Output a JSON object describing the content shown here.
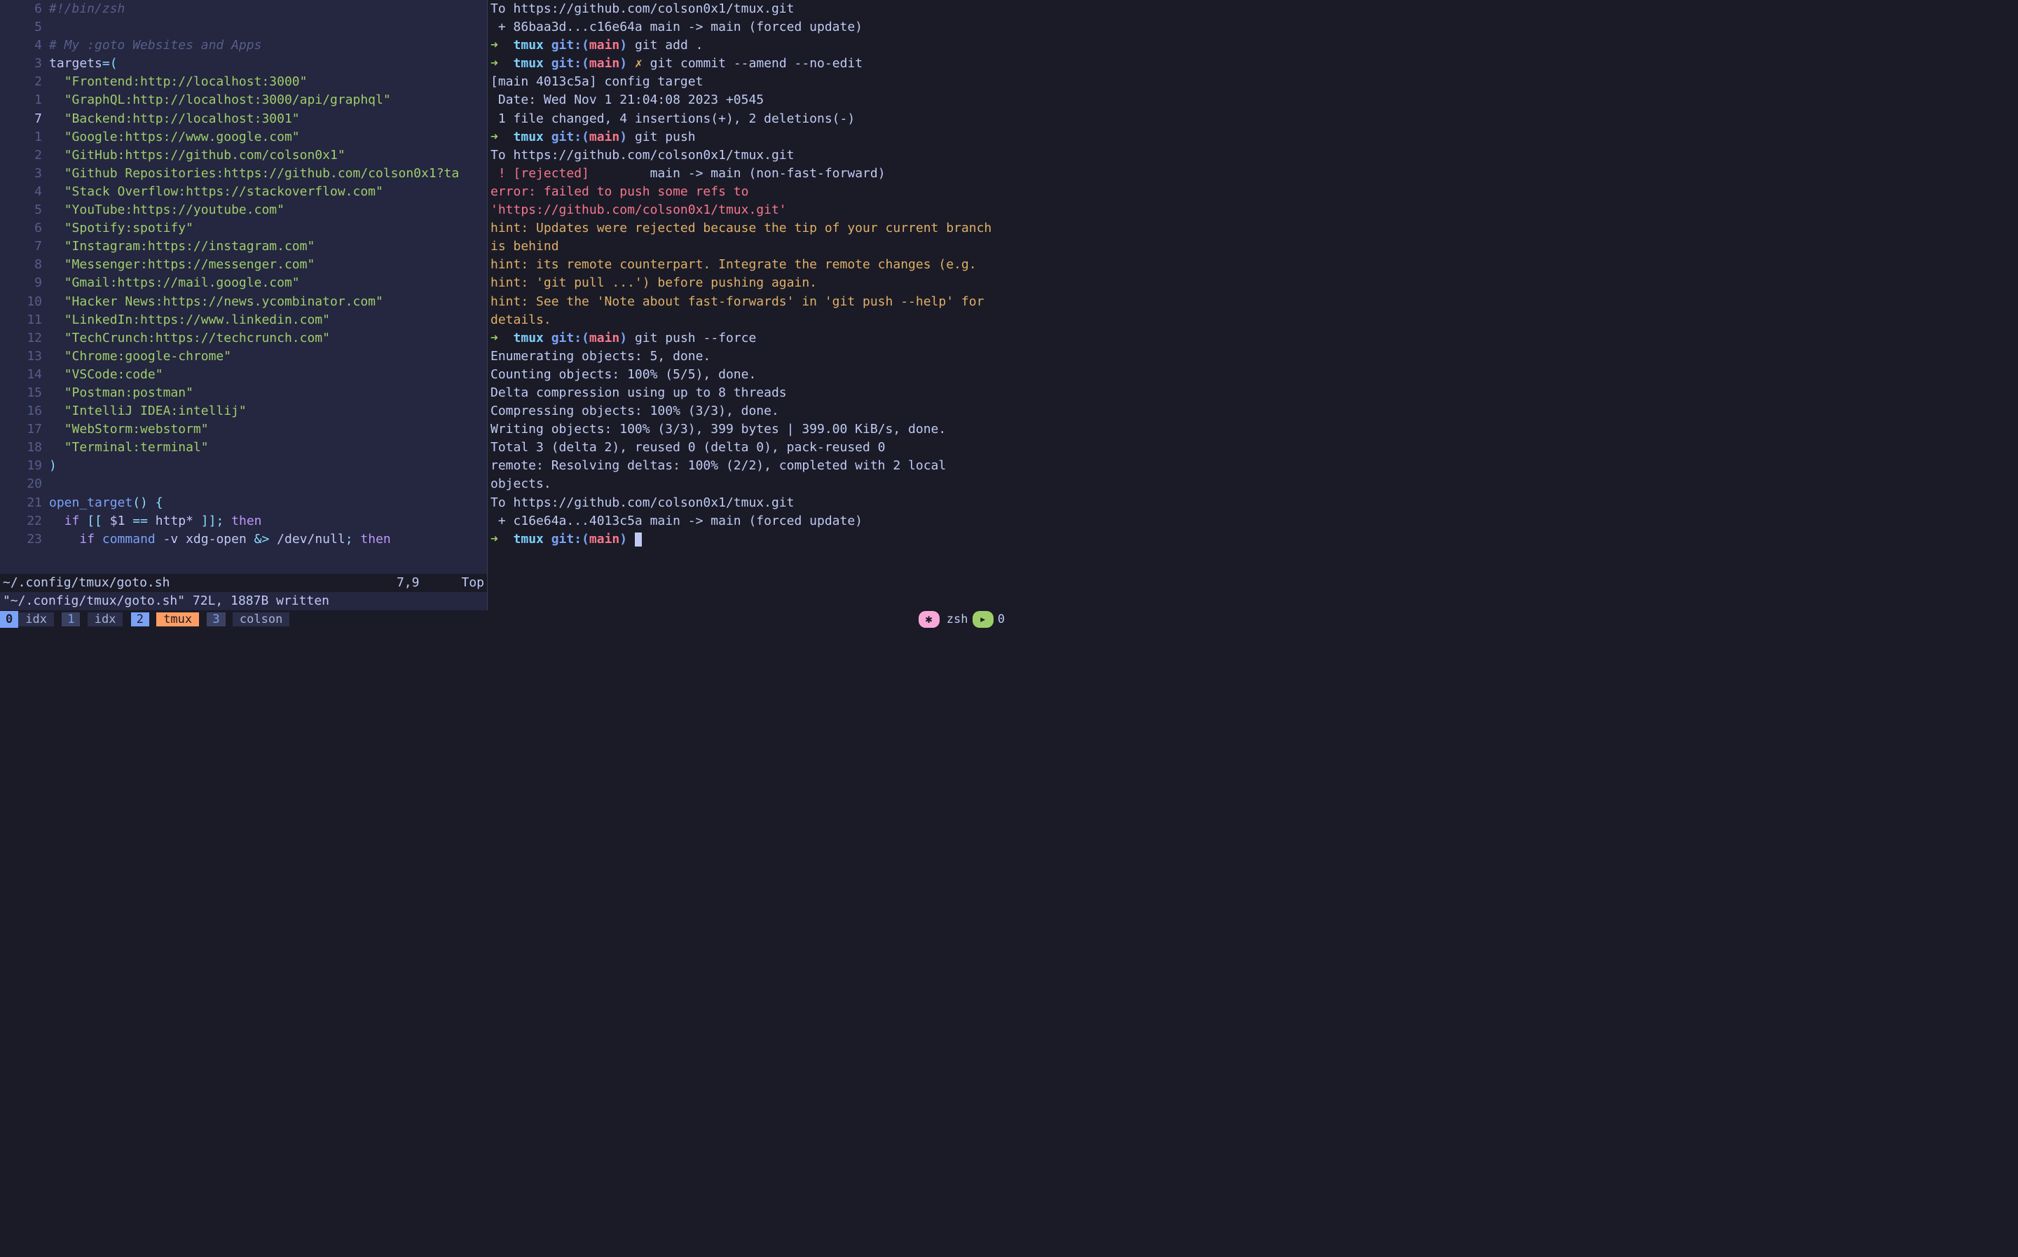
{
  "left": {
    "lines": [
      {
        "n": "6",
        "cursor": false,
        "segs": [
          {
            "cls": "comment",
            "t": "#!/bin/zsh"
          }
        ]
      },
      {
        "n": "5",
        "cursor": false,
        "segs": []
      },
      {
        "n": "4",
        "cursor": false,
        "segs": [
          {
            "cls": "comment",
            "t": "# My :goto Websites and Apps"
          }
        ]
      },
      {
        "n": "3",
        "cursor": false,
        "segs": [
          {
            "cls": "var",
            "t": "targets"
          },
          {
            "cls": "op",
            "t": "=("
          }
        ]
      },
      {
        "n": "2",
        "cursor": false,
        "segs": [
          {
            "cls": "",
            "t": "  "
          },
          {
            "cls": "string",
            "t": "\"Frontend:http://localhost:3000\""
          }
        ]
      },
      {
        "n": "1",
        "cursor": false,
        "segs": [
          {
            "cls": "",
            "t": "  "
          },
          {
            "cls": "string",
            "t": "\"GraphQL:http://localhost:3000/api/graphql\""
          }
        ]
      },
      {
        "n": "7",
        "cursor": true,
        "segs": [
          {
            "cls": "",
            "t": "  "
          },
          {
            "cls": "string",
            "t": "\"Backend:http://localhost:3001\""
          }
        ]
      },
      {
        "n": "1",
        "cursor": false,
        "segs": [
          {
            "cls": "",
            "t": "  "
          },
          {
            "cls": "string",
            "t": "\"Google:https://www.google.com\""
          }
        ]
      },
      {
        "n": "2",
        "cursor": false,
        "segs": [
          {
            "cls": "",
            "t": "  "
          },
          {
            "cls": "string",
            "t": "\"GitHub:https://github.com/colson0x1\""
          }
        ]
      },
      {
        "n": "3",
        "cursor": false,
        "segs": [
          {
            "cls": "",
            "t": "  "
          },
          {
            "cls": "string",
            "t": "\"Github Repositories:https://github.com/colson0x1?ta"
          }
        ]
      },
      {
        "n": "4",
        "cursor": false,
        "segs": [
          {
            "cls": "",
            "t": "  "
          },
          {
            "cls": "string",
            "t": "\"Stack Overflow:https://stackoverflow.com\""
          }
        ]
      },
      {
        "n": "5",
        "cursor": false,
        "segs": [
          {
            "cls": "",
            "t": "  "
          },
          {
            "cls": "string",
            "t": "\"YouTube:https://youtube.com\""
          }
        ]
      },
      {
        "n": "6",
        "cursor": false,
        "segs": [
          {
            "cls": "",
            "t": "  "
          },
          {
            "cls": "string",
            "t": "\"Spotify:spotify\""
          }
        ]
      },
      {
        "n": "7",
        "cursor": false,
        "segs": [
          {
            "cls": "",
            "t": "  "
          },
          {
            "cls": "string",
            "t": "\"Instagram:https://instagram.com\""
          }
        ]
      },
      {
        "n": "8",
        "cursor": false,
        "segs": [
          {
            "cls": "",
            "t": "  "
          },
          {
            "cls": "string",
            "t": "\"Messenger:https://messenger.com\""
          }
        ]
      },
      {
        "n": "9",
        "cursor": false,
        "segs": [
          {
            "cls": "",
            "t": "  "
          },
          {
            "cls": "string",
            "t": "\"Gmail:https://mail.google.com\""
          }
        ]
      },
      {
        "n": "10",
        "cursor": false,
        "segs": [
          {
            "cls": "",
            "t": "  "
          },
          {
            "cls": "string",
            "t": "\"Hacker News:https://news.ycombinator.com\""
          }
        ]
      },
      {
        "n": "11",
        "cursor": false,
        "segs": [
          {
            "cls": "",
            "t": "  "
          },
          {
            "cls": "string",
            "t": "\"LinkedIn:https://www.linkedin.com\""
          }
        ]
      },
      {
        "n": "12",
        "cursor": false,
        "segs": [
          {
            "cls": "",
            "t": "  "
          },
          {
            "cls": "string",
            "t": "\"TechCrunch:https://techcrunch.com\""
          }
        ]
      },
      {
        "n": "13",
        "cursor": false,
        "segs": [
          {
            "cls": "",
            "t": "  "
          },
          {
            "cls": "string",
            "t": "\"Chrome:google-chrome\""
          }
        ]
      },
      {
        "n": "14",
        "cursor": false,
        "segs": [
          {
            "cls": "",
            "t": "  "
          },
          {
            "cls": "string",
            "t": "\"VSCode:code\""
          }
        ]
      },
      {
        "n": "15",
        "cursor": false,
        "segs": [
          {
            "cls": "",
            "t": "  "
          },
          {
            "cls": "string",
            "t": "\"Postman:postman\""
          }
        ]
      },
      {
        "n": "16",
        "cursor": false,
        "segs": [
          {
            "cls": "",
            "t": "  "
          },
          {
            "cls": "string",
            "t": "\"IntelliJ IDEA:intellij\""
          }
        ]
      },
      {
        "n": "17",
        "cursor": false,
        "segs": [
          {
            "cls": "",
            "t": "  "
          },
          {
            "cls": "string",
            "t": "\"WebStorm:webstorm\""
          }
        ]
      },
      {
        "n": "18",
        "cursor": false,
        "segs": [
          {
            "cls": "",
            "t": "  "
          },
          {
            "cls": "string",
            "t": "\"Terminal:terminal\""
          }
        ]
      },
      {
        "n": "19",
        "cursor": false,
        "segs": [
          {
            "cls": "op",
            "t": ")"
          }
        ]
      },
      {
        "n": "20",
        "cursor": false,
        "segs": []
      },
      {
        "n": "21",
        "cursor": false,
        "segs": [
          {
            "cls": "func",
            "t": "open_target"
          },
          {
            "cls": "op",
            "t": "() {"
          }
        ]
      },
      {
        "n": "22",
        "cursor": false,
        "segs": [
          {
            "cls": "",
            "t": "  "
          },
          {
            "cls": "keyword",
            "t": "if"
          },
          {
            "cls": "op",
            "t": " [[ "
          },
          {
            "cls": "var",
            "t": "$1"
          },
          {
            "cls": "op",
            "t": " == "
          },
          {
            "cls": "var",
            "t": "http*"
          },
          {
            "cls": "op",
            "t": " ]]; "
          },
          {
            "cls": "keyword",
            "t": "then"
          }
        ]
      },
      {
        "n": "23",
        "cursor": false,
        "segs": [
          {
            "cls": "",
            "t": "    "
          },
          {
            "cls": "keyword",
            "t": "if"
          },
          {
            "cls": "func",
            "t": " command"
          },
          {
            "cls": "var",
            "t": " -v xdg-open "
          },
          {
            "cls": "op",
            "t": "&> "
          },
          {
            "cls": "var",
            "t": "/dev/null"
          },
          {
            "cls": "op",
            "t": "; "
          },
          {
            "cls": "keyword",
            "t": "then"
          }
        ]
      }
    ],
    "status_file": "~/.config/tmux/goto.sh",
    "status_pos": "7,9",
    "status_side": "Top",
    "msg": "\"~/.config/tmux/goto.sh\" 72L, 1887B written"
  },
  "right": {
    "lines": [
      {
        "segs": [
          {
            "cls": "",
            "t": "To https://github.com/colson0x1/tmux.git"
          }
        ]
      },
      {
        "segs": [
          {
            "cls": "",
            "t": " + 86baa3d...c16e64a main -> main (forced update)"
          }
        ]
      },
      {
        "segs": [
          {
            "cls": "arrow",
            "t": "➜  "
          },
          {
            "cls": "dir",
            "t": "tmux "
          },
          {
            "cls": "git-label",
            "t": "git:"
          },
          {
            "cls": "paren",
            "t": "("
          },
          {
            "cls": "branch",
            "t": "main"
          },
          {
            "cls": "paren",
            "t": ") "
          },
          {
            "cls": "cmd",
            "t": "git add ."
          }
        ]
      },
      {
        "segs": [
          {
            "cls": "arrow",
            "t": "➜  "
          },
          {
            "cls": "dir",
            "t": "tmux "
          },
          {
            "cls": "git-label",
            "t": "git:"
          },
          {
            "cls": "paren",
            "t": "("
          },
          {
            "cls": "branch",
            "t": "main"
          },
          {
            "cls": "paren",
            "t": ") "
          },
          {
            "cls": "yellowx",
            "t": "✗ "
          },
          {
            "cls": "cmd",
            "t": "git commit --amend --no-edit"
          }
        ]
      },
      {
        "segs": [
          {
            "cls": "",
            "t": "[main 4013c5a] config target"
          }
        ]
      },
      {
        "segs": [
          {
            "cls": "",
            "t": " Date: Wed Nov 1 21:04:08 2023 +0545"
          }
        ]
      },
      {
        "segs": [
          {
            "cls": "",
            "t": " 1 file changed, 4 insertions(+), 2 deletions(-)"
          }
        ]
      },
      {
        "segs": [
          {
            "cls": "arrow",
            "t": "➜  "
          },
          {
            "cls": "dir",
            "t": "tmux "
          },
          {
            "cls": "git-label",
            "t": "git:"
          },
          {
            "cls": "paren",
            "t": "("
          },
          {
            "cls": "branch",
            "t": "main"
          },
          {
            "cls": "paren",
            "t": ") "
          },
          {
            "cls": "cmd",
            "t": "git push"
          }
        ]
      },
      {
        "segs": [
          {
            "cls": "",
            "t": "To https://github.com/colson0x1/tmux.git"
          }
        ]
      },
      {
        "segs": [
          {
            "cls": "red",
            "t": " ! [rejected]        "
          },
          {
            "cls": "",
            "t": "main -> main (non-fast-forward)"
          }
        ]
      },
      {
        "segs": [
          {
            "cls": "red",
            "t": "error: failed to push some refs to 'https://github.com/colson0x1/tmux.git'"
          }
        ]
      },
      {
        "segs": [
          {
            "cls": "yellow",
            "t": "hint: Updates were rejected because the tip of your current branch is behind"
          }
        ]
      },
      {
        "segs": [
          {
            "cls": "yellow",
            "t": "hint: its remote counterpart. Integrate the remote changes (e.g."
          }
        ]
      },
      {
        "segs": [
          {
            "cls": "yellow",
            "t": "hint: 'git pull ...') before pushing again."
          }
        ]
      },
      {
        "segs": [
          {
            "cls": "yellow",
            "t": "hint: See the 'Note about fast-forwards' in 'git push --help' for details."
          }
        ]
      },
      {
        "segs": [
          {
            "cls": "arrow",
            "t": "➜  "
          },
          {
            "cls": "dir",
            "t": "tmux "
          },
          {
            "cls": "git-label",
            "t": "git:"
          },
          {
            "cls": "paren",
            "t": "("
          },
          {
            "cls": "branch",
            "t": "main"
          },
          {
            "cls": "paren",
            "t": ") "
          },
          {
            "cls": "cmd",
            "t": "git push --force"
          }
        ]
      },
      {
        "segs": [
          {
            "cls": "",
            "t": "Enumerating objects: 5, done."
          }
        ]
      },
      {
        "segs": [
          {
            "cls": "",
            "t": "Counting objects: 100% (5/5), done."
          }
        ]
      },
      {
        "segs": [
          {
            "cls": "",
            "t": "Delta compression using up to 8 threads"
          }
        ]
      },
      {
        "segs": [
          {
            "cls": "",
            "t": "Compressing objects: 100% (3/3), done."
          }
        ]
      },
      {
        "segs": [
          {
            "cls": "",
            "t": "Writing objects: 100% (3/3), 399 bytes | 399.00 KiB/s, done."
          }
        ]
      },
      {
        "segs": [
          {
            "cls": "",
            "t": "Total 3 (delta 2), reused 0 (delta 0), pack-reused 0"
          }
        ]
      },
      {
        "segs": [
          {
            "cls": "",
            "t": "remote: Resolving deltas: 100% (2/2), completed with 2 local objects."
          }
        ]
      },
      {
        "segs": [
          {
            "cls": "",
            "t": "To https://github.com/colson0x1/tmux.git"
          }
        ]
      },
      {
        "segs": [
          {
            "cls": "",
            "t": " + c16e64a...4013c5a main -> main (forced update)"
          }
        ]
      },
      {
        "segs": [
          {
            "cls": "arrow",
            "t": "➜  "
          },
          {
            "cls": "dir",
            "t": "tmux "
          },
          {
            "cls": "git-label",
            "t": "git:"
          },
          {
            "cls": "paren",
            "t": "("
          },
          {
            "cls": "branch",
            "t": "main"
          },
          {
            "cls": "paren",
            "t": ") "
          }
        ],
        "cursor": true
      }
    ]
  },
  "tmux": {
    "session": "0",
    "windows": [
      {
        "num": "1",
        "name": "idx",
        "active": false
      },
      {
        "num": "2",
        "name": "idx",
        "active": false
      },
      {
        "num": "2",
        "name": "tmux",
        "active": true,
        "numdisplay": "2"
      },
      {
        "num": "3",
        "name": "colson",
        "active": false
      }
    ],
    "right_label": "zsh",
    "right_count": "0"
  }
}
